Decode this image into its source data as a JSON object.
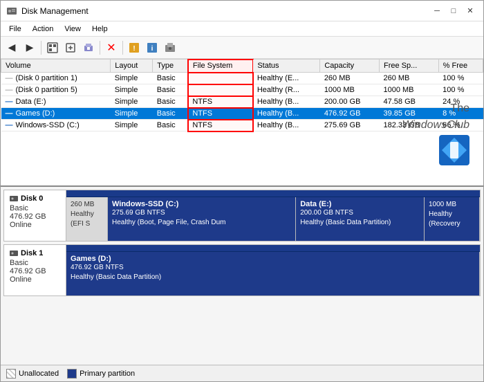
{
  "window": {
    "title": "Disk Management",
    "controls": {
      "minimize": "─",
      "maximize": "□",
      "close": "✕"
    }
  },
  "menu": {
    "items": [
      "File",
      "Action",
      "View",
      "Help"
    ]
  },
  "toolbar": {
    "buttons": [
      "◀",
      "▶",
      "⊡",
      "⊞",
      "⊟",
      "✕",
      "⊛",
      "⊠",
      "⊡"
    ]
  },
  "table": {
    "columns": [
      "Volume",
      "Layout",
      "Type",
      "File System",
      "Status",
      "Capacity",
      "Free Sp...",
      "% Free"
    ],
    "rows": [
      {
        "volume": "(Disk 0 partition 1)",
        "layout": "Simple",
        "type": "Basic",
        "filesystem": "",
        "status": "Healthy (E...",
        "capacity": "260 MB",
        "free": "260 MB",
        "pct_free": "100 %"
      },
      {
        "volume": "(Disk 0 partition 5)",
        "layout": "Simple",
        "type": "Basic",
        "filesystem": "",
        "status": "Healthy (R...",
        "capacity": "1000 MB",
        "free": "1000 MB",
        "pct_free": "100 %"
      },
      {
        "volume": "Data (E:)",
        "layout": "Simple",
        "type": "Basic",
        "filesystem": "NTFS",
        "status": "Healthy (B...",
        "capacity": "200.00 GB",
        "free": "47.58 GB",
        "pct_free": "24 %"
      },
      {
        "volume": "Games (D:)",
        "layout": "Simple",
        "type": "Basic",
        "filesystem": "NTFS",
        "status": "Healthy (B...",
        "capacity": "476.92 GB",
        "free": "39.85 GB",
        "pct_free": "8 %",
        "selected": true
      },
      {
        "volume": "Windows-SSD (C:)",
        "layout": "Simple",
        "type": "Basic",
        "filesystem": "NTFS",
        "status": "Healthy (B...",
        "capacity": "275.69 GB",
        "free": "182.33 GB",
        "pct_free": "66 %"
      }
    ]
  },
  "disk0": {
    "name": "Disk 0",
    "type": "Basic",
    "size": "476.92 GB",
    "status": "Online",
    "partitions": [
      {
        "id": "efi",
        "name": "",
        "size": "260 MB",
        "info": "Healthy (EFI S",
        "bg": "gray"
      },
      {
        "id": "windows",
        "name": "Windows-SSD (C:)",
        "size": "275.69 GB NTFS",
        "info": "Healthy (Boot, Page File, Crash Dum",
        "bg": "dark-blue"
      },
      {
        "id": "data",
        "name": "Data (E:)",
        "size": "200.00 GB NTFS",
        "info": "Healthy (Basic Data Partition)",
        "bg": "dark-blue"
      },
      {
        "id": "recovery",
        "name": "",
        "size": "1000 MB",
        "info": "Healthy (Recovery",
        "bg": "dark-blue"
      }
    ]
  },
  "disk1": {
    "name": "Disk 1",
    "type": "Basic",
    "size": "476.92 GB",
    "status": "Online",
    "partitions": [
      {
        "id": "games",
        "name": "Games (D:)",
        "size": "476.92 GB NTFS",
        "info": "Healthy (Basic Data Partition)",
        "bg": "dark-blue"
      }
    ]
  },
  "legend": {
    "items": [
      {
        "label": "Unallocated",
        "color": "#d0d0d0"
      },
      {
        "label": "Primary partition",
        "color": "#1e3a8a"
      }
    ]
  },
  "watermark": {
    "line1": "The",
    "line2": "WindowsClub"
  }
}
